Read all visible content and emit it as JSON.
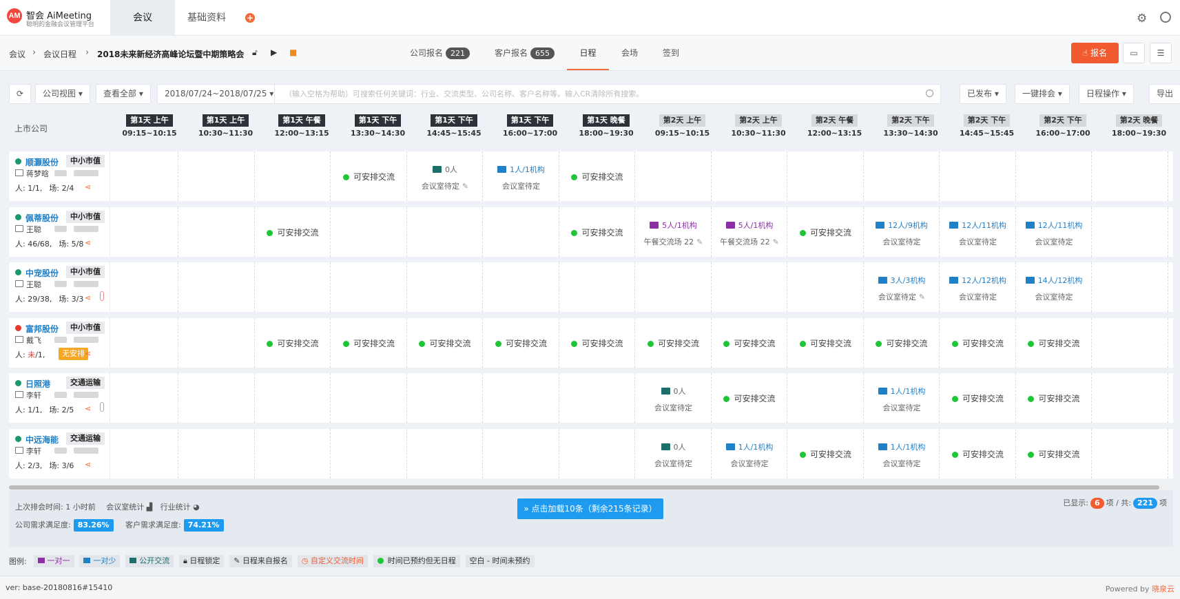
{
  "brand": {
    "name": "智会 AiMeeting",
    "tagline": "聪明的金融会议管理平台",
    "logo_text": "AM"
  },
  "nav": {
    "active": "会议",
    "other": "基础资料",
    "add": "+"
  },
  "breadcrumb": [
    "会议",
    "会议日程",
    "2018未来新经济高峰论坛暨中期策略会"
  ],
  "subtabs": {
    "company_reg": {
      "label": "公司报名",
      "count": "221"
    },
    "client_reg": {
      "label": "客户报名",
      "count": "655"
    },
    "schedule": "日程",
    "venue": "会场",
    "checkin": "签到"
  },
  "actions": {
    "register": "报名"
  },
  "toolbar": {
    "company_view": "公司视图 ▾",
    "view_all": "查看全部 ▾",
    "date_range": "2018/07/24~2018/07/25 ▾",
    "search_placeholder": "（输入空格为帮助）可搜索任何关键词：行业、交流类型、公司名称、客户名称等。输入CR清除所有搜索。",
    "published": "已发布 ▾",
    "auto_arrange": "一键排会 ▾",
    "schedule_ops": "日程操作 ▾",
    "export": "导出"
  },
  "grid": {
    "corner": "上市公司",
    "columns": [
      {
        "label": "第1天 上午",
        "time": "09:15~10:15"
      },
      {
        "label": "第1天 上午",
        "time": "10:30~11:30"
      },
      {
        "label": "第1天 午餐",
        "time": "12:00~13:15"
      },
      {
        "label": "第1天 下午",
        "time": "13:30~14:30"
      },
      {
        "label": "第1天 下午",
        "time": "14:45~15:45"
      },
      {
        "label": "第1天 下午",
        "time": "16:00~17:00"
      },
      {
        "label": "第1天 晚餐",
        "time": "18:00~19:30"
      },
      {
        "label": "第2天 上午",
        "time": "09:15~10:15"
      },
      {
        "label": "第2天 上午",
        "time": "10:30~11:30"
      },
      {
        "label": "第2天 午餐",
        "time": "12:00~13:15"
      },
      {
        "label": "第2天 下午",
        "time": "13:30~14:30"
      },
      {
        "label": "第2天 下午",
        "time": "14:45~15:45"
      },
      {
        "label": "第2天 下午",
        "time": "16:00~17:00"
      },
      {
        "label": "第2天 晚餐",
        "time": "18:00~19:30"
      }
    ],
    "available_text": "可安排交流",
    "pending_text": "会议室待定",
    "rows": [
      {
        "name": "顺灏股份",
        "tag": "中小市值",
        "person": "蒋梦晗",
        "stat_a": "人: 1/1,",
        "stat_b": "场: 2/4",
        "status": "green",
        "cells": [
          null,
          null,
          null,
          {
            "t": "avail"
          },
          {
            "t": "mtg",
            "text": "0人",
            "color": "teal",
            "sub": "会议室待定",
            "pen": true
          },
          {
            "t": "mtg",
            "text": "1人/1机构",
            "color": "blue",
            "sub": "会议室待定"
          },
          {
            "t": "avail"
          },
          null,
          null,
          null,
          null,
          null,
          null,
          null
        ]
      },
      {
        "name": "佩蒂股份",
        "tag": "中小市值",
        "person": "王聪",
        "stat_a": "人: 46/68,",
        "stat_b": "场: 5/8",
        "status": "green",
        "cells": [
          null,
          null,
          {
            "t": "avail"
          },
          null,
          null,
          null,
          {
            "t": "avail"
          },
          {
            "t": "mtg",
            "text": "5人/1机构",
            "color": "purple",
            "sub": "午餐交流场 22",
            "pen": true
          },
          {
            "t": "mtg",
            "text": "5人/1机构",
            "color": "purple",
            "sub": "午餐交流场 22",
            "pen": true
          },
          {
            "t": "avail"
          },
          {
            "t": "mtg",
            "text": "12人/9机构",
            "color": "blue",
            "sub": "会议室待定"
          },
          {
            "t": "mtg",
            "text": "12人/11机构",
            "color": "blue",
            "sub": "会议室待定"
          },
          {
            "t": "mtg",
            "text": "12人/11机构",
            "color": "blue",
            "sub": "会议室待定"
          },
          null
        ]
      },
      {
        "name": "中宠股份",
        "tag": "中小市值",
        "person": "王聪",
        "stat_a": "人: 29/38,",
        "stat_b": "场: 3/3",
        "status": "green",
        "thermo": "red",
        "cells": [
          null,
          null,
          null,
          null,
          null,
          null,
          null,
          null,
          null,
          null,
          {
            "t": "mtg",
            "text": "3人/3机构",
            "color": "blue",
            "sub": "会议室待定",
            "pen": true
          },
          {
            "t": "mtg",
            "text": "12人/12机构",
            "color": "blue",
            "sub": "会议室待定"
          },
          {
            "t": "mtg",
            "text": "14人/12机构",
            "color": "blue",
            "sub": "会议室待定"
          },
          null
        ]
      },
      {
        "name": "富邦股份",
        "tag": "中小市值",
        "person": "戴飞",
        "stat_pre": "人: ",
        "stat_red": "未",
        "stat_post": "/1,",
        "no_arrange": "无安排",
        "status": "red",
        "cells": [
          null,
          null,
          {
            "t": "avail"
          },
          {
            "t": "avail"
          },
          {
            "t": "avail"
          },
          {
            "t": "avail"
          },
          {
            "t": "avail"
          },
          {
            "t": "avail"
          },
          {
            "t": "avail"
          },
          {
            "t": "avail"
          },
          {
            "t": "avail"
          },
          {
            "t": "avail"
          },
          {
            "t": "avail"
          },
          null
        ]
      },
      {
        "name": "日照港",
        "tag": "交通运输",
        "person": "李轩",
        "stat_a": "人: 1/1,",
        "stat_b": "场: 2/5",
        "status": "green",
        "thermo": "gray",
        "cells": [
          null,
          null,
          null,
          null,
          null,
          null,
          null,
          {
            "t": "mtg",
            "text": "0人",
            "color": "teal",
            "sub": "会议室待定"
          },
          {
            "t": "avail"
          },
          null,
          {
            "t": "mtg",
            "text": "1人/1机构",
            "color": "blue",
            "sub": "会议室待定"
          },
          {
            "t": "avail"
          },
          {
            "t": "avail"
          },
          null
        ]
      },
      {
        "name": "中远海能",
        "tag": "交通运输",
        "person": "李轩",
        "stat_a": "人: 2/3,",
        "stat_b": "场: 3/6",
        "status": "green",
        "cells": [
          null,
          null,
          null,
          null,
          null,
          null,
          null,
          {
            "t": "mtg",
            "text": "0人",
            "color": "teal",
            "sub": "会议室待定"
          },
          {
            "t": "mtg",
            "text": "1人/1机构",
            "color": "blue",
            "sub": "会议室待定"
          },
          {
            "t": "avail"
          },
          {
            "t": "mtg",
            "text": "1人/1机构",
            "color": "blue",
            "sub": "会议室待定"
          },
          {
            "t": "avail"
          },
          {
            "t": "avail"
          },
          null
        ]
      }
    ]
  },
  "footer": {
    "last_arrange": "上次排会时间: 1 小时前",
    "room_stats": "会议室统计",
    "industry_stats": "行业统计",
    "company_sat_label": "公司需求满足度:",
    "company_sat": "83.26%",
    "client_sat_label": "客户需求满足度:",
    "client_sat": "74.21%",
    "load_more": "点击加载10条（剩余215条记录）",
    "shown_label": "已显示:",
    "shown": "6",
    "total_label": "项 / 共:",
    "total": "221",
    "item_unit": "项"
  },
  "legend": {
    "label": "图例:",
    "items": [
      "一对一",
      "一对少",
      "公开交流",
      "日程锁定",
      "日程来自报名",
      "自定义交流时间",
      "时间已预约但无日程",
      "空白 - 时间未预约"
    ]
  },
  "bottom": {
    "version": "ver: base-20180816#15410",
    "powered": "Powered by",
    "powered_brand": "晓泉云"
  },
  "colors": {
    "accent": "#f25b30",
    "blue": "#1e9bf0",
    "green": "#1ec536",
    "purple": "#8c2ea6"
  }
}
